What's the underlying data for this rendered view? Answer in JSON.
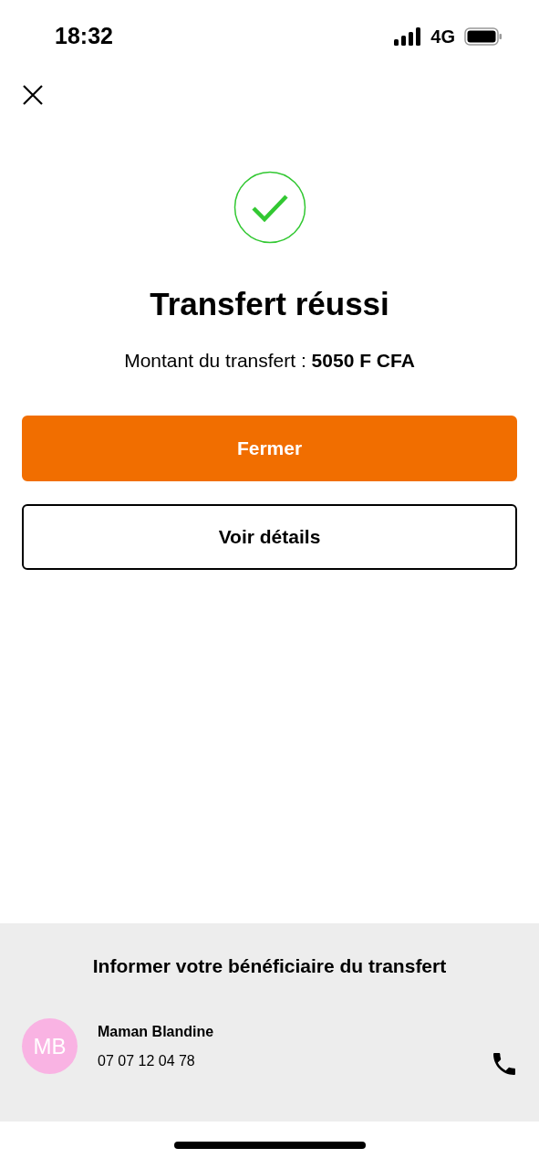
{
  "status_bar": {
    "time": "18:32",
    "network": "4G"
  },
  "title": "Transfert réussi",
  "amount_line": "Montant du transfert : **5050 F CFA**",
  "buttons": [
    {
      "label": "Fermer",
      "kind": "primary"
    },
    {
      "label": "Voir détails",
      "kind": "outline"
    }
  ],
  "inform": {
    "title": "Informer votre bénéficiaire du transfert",
    "contact": {
      "initials": "MB",
      "name": "Maman Blandine",
      "phone": "07 07 12 04 78",
      "color": "#f9b3e3"
    }
  }
}
